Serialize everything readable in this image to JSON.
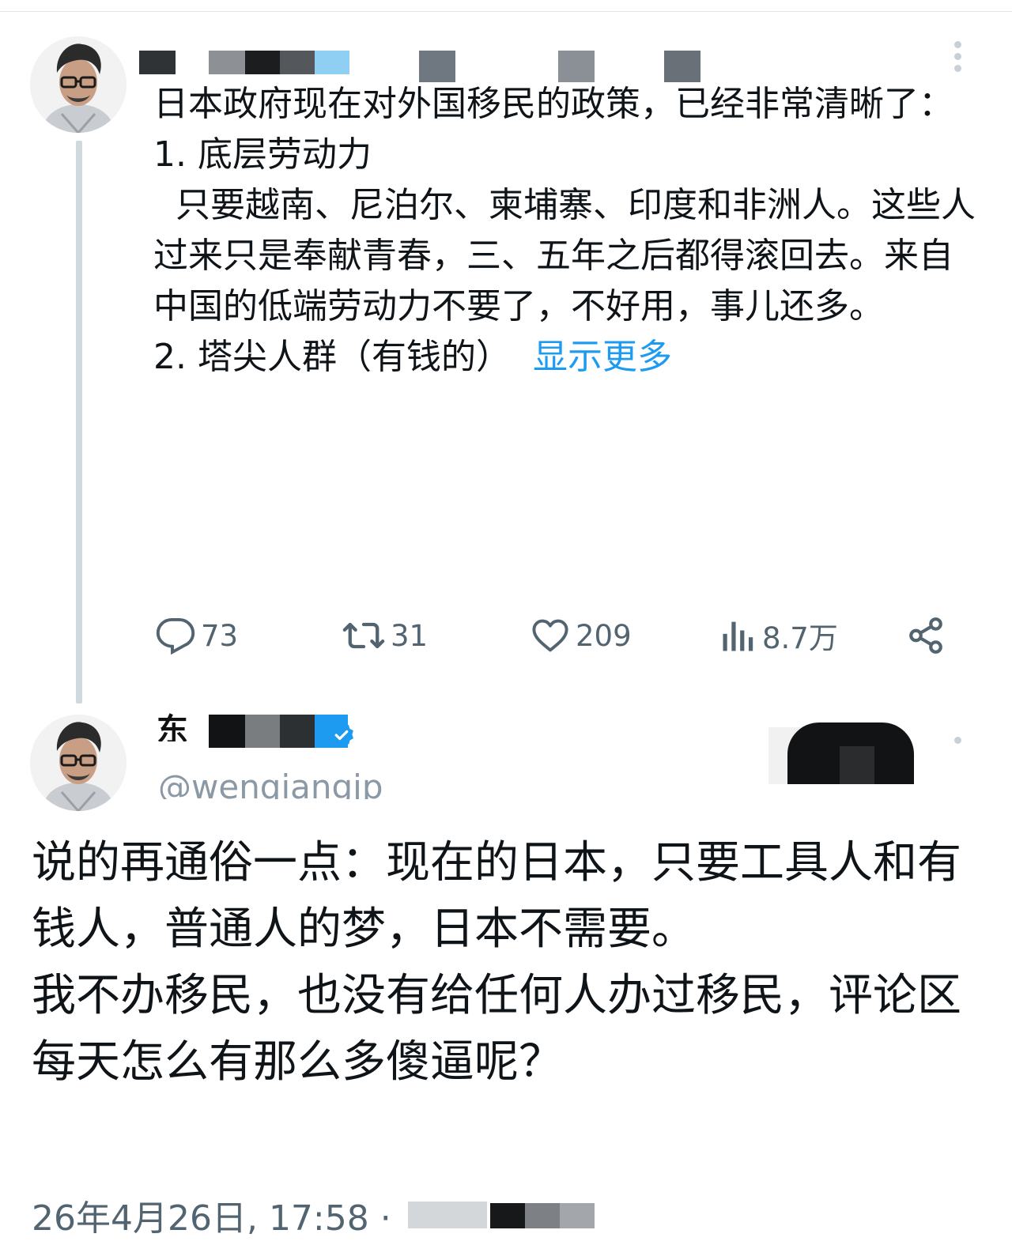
{
  "post1": {
    "body_lines": [
      "日本政府现在对外国移民的政策，已经非常清晰了：",
      "",
      "1. 底层劳动力",
      "  只要越南、尼泊尔、柬埔寨、印度和非洲人。这些人过来只是奉献青春，三、五年之后都得滚回去。来自中国的低端劳动力不要了，不好用，事儿还多。",
      "",
      "2. 塔尖人群（有钱的）"
    ],
    "show_more": "显示更多",
    "actions": {
      "reply_count": "73",
      "retweet_count": "31",
      "like_count": "209",
      "views_count": "8.7万"
    }
  },
  "post2": {
    "name_fragment": "东",
    "handle": "@wenqiangjp",
    "body_lines": [
      "说的再通俗一点：现在的日本，只要工具人和有钱人，普通人的梦，日本不需要。",
      "",
      "我不办移民，也没有给任何人办过移民，评论区每天怎么有那么多傻逼呢？"
    ],
    "timestamp": "26年4月26日, 17:58 ·"
  },
  "icons": {
    "reply": "reply-icon",
    "retweet": "retweet-icon",
    "like": "heart-icon",
    "views": "views-icon",
    "share": "share-icon",
    "more": "more-icon",
    "verified": "verified-badge-icon"
  },
  "colors": {
    "link": "#1d9bf0",
    "muted": "#536471",
    "thread_line": "#cfd9de"
  }
}
